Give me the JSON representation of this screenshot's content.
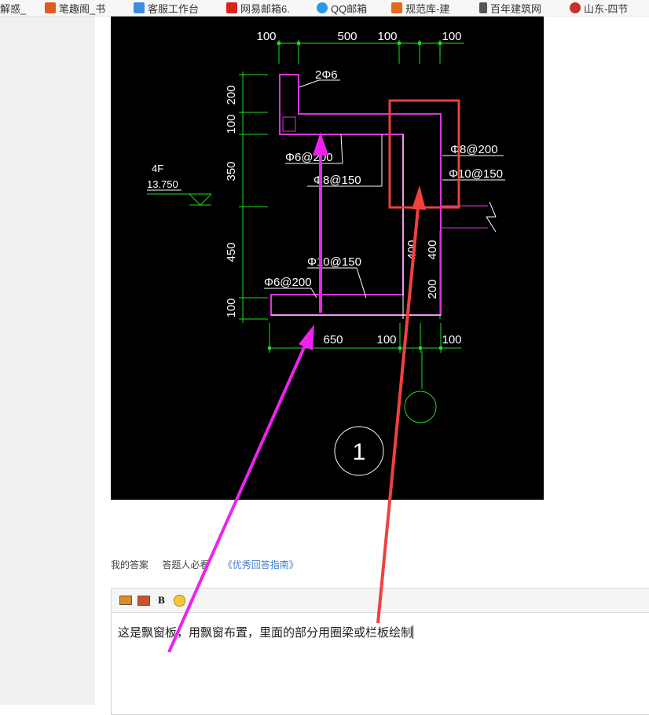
{
  "bookmarks": [
    {
      "label": "解惑_",
      "icon": "bookmark-icon",
      "color": "#f7f7f7"
    },
    {
      "label": "笔趣阁_书",
      "icon": "house-icon",
      "color": "#e25b1c"
    },
    {
      "label": "客服工作台",
      "icon": "download-icon",
      "color": "#3c8de0"
    },
    {
      "label": "网易邮箱6.",
      "icon": "netease-mail-icon",
      "color": "#d9231d"
    },
    {
      "label": "QQ邮箱",
      "icon": "qq-mail-icon",
      "color": "#2a9ae8"
    },
    {
      "label": "规范库-建",
      "icon": "book-icon",
      "color": "#e66a1c"
    },
    {
      "label": "百年建筑网",
      "icon": "document-icon",
      "color": "#555555"
    },
    {
      "label": "山东-四节",
      "icon": "globe-icon",
      "color": "#c8302c"
    }
  ],
  "drawing": {
    "dims_top": [
      "100",
      "500",
      "100",
      "100"
    ],
    "dims_left": [
      "200",
      "100",
      "350",
      "450",
      "100"
    ],
    "dims_bottom": [
      "650",
      "100",
      "100"
    ],
    "dims_right": [
      "400",
      "200"
    ],
    "dims_inner": "400",
    "labels": {
      "top_bar": "2Φ6",
      "stirrup_left": "Φ6@200",
      "bar_150": "Φ8@150",
      "stirrup_right": "Φ8@200",
      "bar_right": "Φ10@150",
      "bottom_bar": "Φ10@150",
      "bottom_stirrup": "Φ6@200"
    },
    "floor": "4F",
    "elevation": "13.750",
    "detail_no": "1"
  },
  "answer": {
    "my_answer": "我的答案",
    "must_read": "答题人必看",
    "guide": "《优秀回答指南》"
  },
  "editor": {
    "text": "这是飘窗板，用飘窗布置，里面的部分用圈梁或栏板绘制",
    "bold_label": "B"
  },
  "colors": {
    "magenta_arrow": "#ee22ee",
    "red_arrow": "#f04040",
    "highlight_box": "#e84040",
    "dimension_green": "#22dd22",
    "rebar_magenta": "#dd33dd"
  }
}
